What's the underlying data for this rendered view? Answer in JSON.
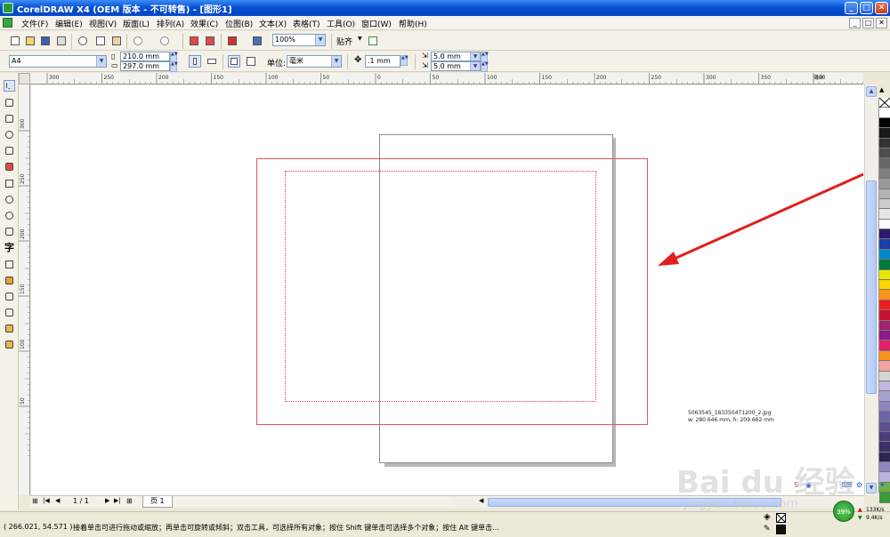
{
  "window": {
    "title": "CorelDRAW X4 (OEM 版本 - 不可转售) - [图形1]",
    "min": "_",
    "max": "□",
    "close": "✕"
  },
  "menu": {
    "items": [
      "文件(F)",
      "编辑(E)",
      "视图(V)",
      "版面(L)",
      "排列(A)",
      "效果(C)",
      "位图(B)",
      "文本(X)",
      "表格(T)",
      "工具(O)",
      "窗口(W)",
      "帮助(H)"
    ],
    "mdi": [
      "_",
      "□",
      "✕"
    ]
  },
  "standard_toolbar": {
    "zoom": "100%",
    "snap": "贴齐"
  },
  "property_bar": {
    "paper": "A4",
    "width": "210.0 mm",
    "height": "297.0 mm",
    "units_label": "单位:",
    "units": "毫米",
    "nudge": ".1 mm",
    "dup_x": "5.0 mm",
    "dup_y": "5.0 mm"
  },
  "ruler": {
    "h_labels": [
      "300",
      "250",
      "200",
      "150",
      "100",
      "50",
      "0",
      "50",
      "100",
      "150",
      "200",
      "250",
      "300",
      "350",
      "400"
    ],
    "h_unit": "毫米",
    "v_labels": [
      "300",
      "250",
      "200",
      "150",
      "100",
      "50"
    ]
  },
  "canvas": {
    "info_line1": "5063545_183350471200_2.jpg",
    "info_line2": "w: 280.646 mm, h: 209.662 mm"
  },
  "page_nav": {
    "counter": "1 / 1",
    "tab": "页 1"
  },
  "status": {
    "coords": "( 266.021, 54.571 )",
    "message": "接着单击可进行拖动或缩放；再单击可旋转或倾斜；双击工具，可选择所有对象；按住 Shift 键单击可选择多个对象；按住 Alt 键单击..."
  },
  "net": {
    "percent": "39%",
    "up": "133K/s",
    "down": "9.4K/s"
  },
  "watermark": {
    "main": "Bai du 经验",
    "sub": "jingyan.baidu.com"
  },
  "colors": {
    "accent_red": "#e0424c",
    "arrow": "#e0201c",
    "xp_blue": "#0a53d6"
  },
  "palette": [
    "#ffffff",
    "#000000",
    "#1a1a1a",
    "#333333",
    "#4d4d4d",
    "#666666",
    "#808080",
    "#999999",
    "#b3b3b3",
    "#cccccc",
    "#e6e6e6",
    "#ffffff",
    "#2e1a6e",
    "#1b3fa6",
    "#0088cc",
    "#007a3d",
    "#e6e600",
    "#ffd400",
    "#f7941d",
    "#ed1c24",
    "#c8102e",
    "#a0246e",
    "#8b1a8b",
    "#e0226e",
    "#f7941d",
    "#f4a3a3",
    "#d4d4d4",
    "#c0b8e0",
    "#a7a2d1",
    "#8d86bf",
    "#6d66a8",
    "#5d5090",
    "#4a3f7a",
    "#3b3166",
    "#2e2552",
    "#8d86bf",
    "#b8b3dd",
    "#6ab04c",
    "#3a9a3a"
  ]
}
